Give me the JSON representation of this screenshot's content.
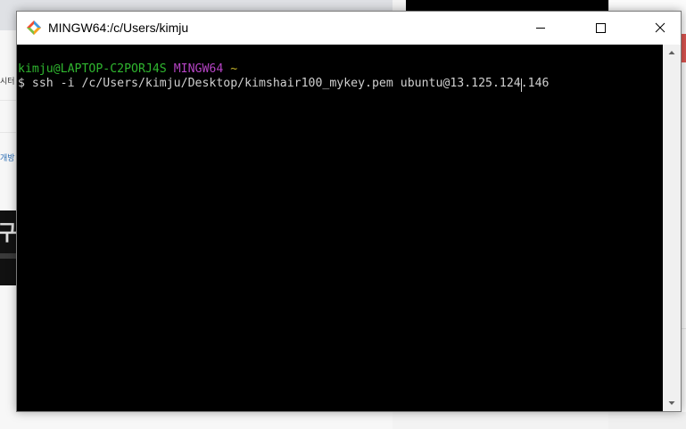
{
  "window": {
    "title": "MINGW64:/c/Users/kimju"
  },
  "terminal": {
    "prompt_user": "kimju@LAPTOP-C2PORJ4S",
    "prompt_env": "MINGW64",
    "prompt_dir": "~",
    "prompt_symbol": "$",
    "command": " ssh -i /c/Users/kimju/Desktop/kimshair100_mykey.pem ubuntu@13.125.124.146"
  },
  "background": {
    "frag_1": "시터",
    "frag_2": "개방",
    "big_glyph": "구"
  },
  "colors": {
    "prompt_user": "#2fb62f",
    "prompt_env": "#b543c4",
    "prompt_dir": "#c7b62b",
    "text": "#d0d0d0",
    "terminal_bg": "#000000"
  },
  "icons": {
    "app": "git-diamond-icon",
    "minimize": "minimize-icon",
    "maximize": "maximize-icon",
    "close": "close-icon",
    "scroll_up": "scroll-up-arrow-icon",
    "scroll_down": "scroll-down-arrow-icon"
  }
}
